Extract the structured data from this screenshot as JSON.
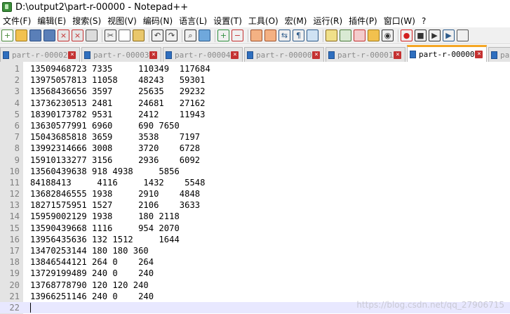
{
  "window": {
    "title": "D:\\output2\\part-r-00000 - Notepad++"
  },
  "menu": [
    "文件(F)",
    "编辑(E)",
    "搜索(S)",
    "视图(V)",
    "编码(N)",
    "语言(L)",
    "设置(T)",
    "工具(O)",
    "宏(M)",
    "运行(R)",
    "插件(P)",
    "窗口(W)",
    "?"
  ],
  "toolbar_icons": [
    "new-file-icon",
    "open-file-icon",
    "save-icon",
    "save-all-icon",
    "close-icon",
    "close-all-icon",
    "print-icon",
    "cut-icon",
    "copy-icon",
    "paste-icon",
    "undo-icon",
    "redo-icon",
    "find-icon",
    "replace-icon",
    "zoom-in-icon",
    "zoom-out-icon",
    "sync-vertical-icon",
    "sync-horizontal-icon",
    "word-wrap-icon",
    "show-all-chars-icon",
    "indent-guide-icon",
    "user-language-icon",
    "document-map-icon",
    "function-list-icon",
    "folder-workspace-icon",
    "monitoring-icon",
    "record-macro-icon",
    "stop-record-icon",
    "play-macro-icon",
    "run-macro-multiple-icon",
    "save-macro-icon"
  ],
  "tabs": [
    {
      "label": "part-r-00002",
      "active": false
    },
    {
      "label": "part-r-00003",
      "active": false
    },
    {
      "label": "part-r-00004",
      "active": false
    },
    {
      "label": "part-r-00000",
      "active": false
    },
    {
      "label": "part-r-00001",
      "active": false
    },
    {
      "label": "part-r-00000",
      "active": true
    },
    {
      "label": "pa",
      "active": false
    }
  ],
  "editor": {
    "lines": [
      "13509468723 7335     110349  117684",
      "13975057813 11058    48243   59301",
      "13568436656 3597     25635   29232",
      "13736230513 2481     24681   27162",
      "18390173782 9531     2412    11943",
      "13630577991 6960     690 7650",
      "15043685818 3659     3538    7197",
      "13992314666 3008     3720    6728",
      "15910133277 3156     2936    6092",
      "13560439638 918 4938     5856",
      "84188413     4116     1432    5548",
      "13682846555 1938     2910    4848",
      "18271575951 1527     2106    3633",
      "15959002129 1938     180 2118",
      "13590439668 1116     954 2070",
      "13956435636 132 1512     1644",
      "13470253144 180 180 360",
      "13846544121 264 0    264",
      "13729199489 240 0    240",
      "13768778790 120 120 240",
      "13966251146 240 0    240",
      ""
    ],
    "current_line": 22
  },
  "watermark": "https://blog.csdn.net/qq_27906715"
}
